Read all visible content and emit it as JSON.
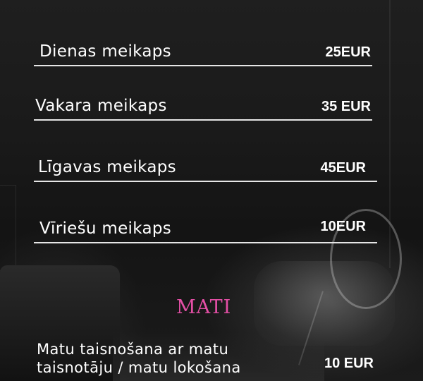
{
  "colors": {
    "background": "#161616",
    "text": "#ffffff",
    "divider": "#e6e6e6",
    "section_accent": "#e44fa6"
  },
  "services": [
    {
      "name": "Dienas meikaps",
      "price": "25EUR"
    },
    {
      "name": "Vakara meikaps",
      "price": "35 EUR"
    },
    {
      "name": "Līgavas meikaps",
      "price": "45EUR"
    },
    {
      "name": "Vīriešu meikaps",
      "price": "10EUR"
    }
  ],
  "hair_section": {
    "title": "MATI",
    "items": [
      {
        "name": "Matu taisnošana ar matu taisnotāju / matu lokošana",
        "price": "10 EUR"
      }
    ]
  }
}
